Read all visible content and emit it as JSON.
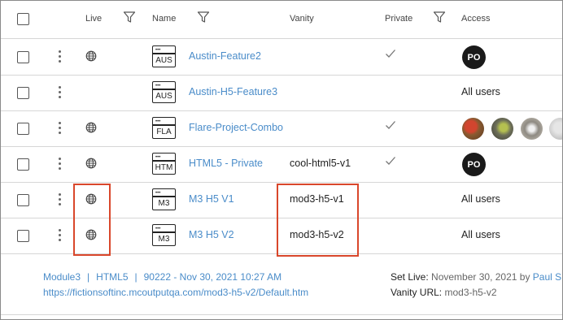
{
  "header": {
    "live": "Live",
    "name": "Name",
    "vanity": "Vanity",
    "private": "Private",
    "access": "Access"
  },
  "rows": [
    {
      "ext": "AUS",
      "name": "Austin-Feature2",
      "vanity": "",
      "private": true,
      "access": "avatar",
      "avatar_initials": "PO",
      "live": true
    },
    {
      "ext": "AUS",
      "name": "Austin-H5-Feature3",
      "vanity": "",
      "private": false,
      "access": "All users",
      "live": false
    },
    {
      "ext": "FLA",
      "name": "Flare-Project-Combo",
      "vanity": "",
      "private": true,
      "access": "photos",
      "live": true
    },
    {
      "ext": "HTM",
      "name": "HTML5 - Private",
      "vanity": "cool-html5-v1",
      "private": true,
      "access": "avatar",
      "avatar_initials": "PO",
      "live": true
    },
    {
      "ext": "M3",
      "name": "M3 H5 V1",
      "vanity": "mod3-h5-v1",
      "private": false,
      "access": "All users",
      "live": true
    },
    {
      "ext": "M3",
      "name": "M3 H5 V2",
      "vanity": "mod3-h5-v2",
      "private": false,
      "access": "All users",
      "live": true
    }
  ],
  "detail": {
    "module": "Module3",
    "target": "HTML5",
    "build": "90222 - Nov 30, 2021 10:27 AM",
    "url": "https://fictionsoftinc.mcoutputqa.com/mod3-h5-v2/Default.htm",
    "set_live_label": "Set Live:",
    "set_live_value": "November 30, 2021 by",
    "set_live_user": "Paul S",
    "vanity_label": "Vanity URL:",
    "vanity_value": "mod3-h5-v2"
  },
  "colors": {
    "link": "#4a8cc9",
    "highlight": "#d9472b",
    "avatar_bg": "#1a1a1a"
  },
  "icons": [
    "checkbox",
    "filter-icon",
    "kebab-menu-icon",
    "globe-icon",
    "file-icon",
    "checkmark-icon"
  ]
}
